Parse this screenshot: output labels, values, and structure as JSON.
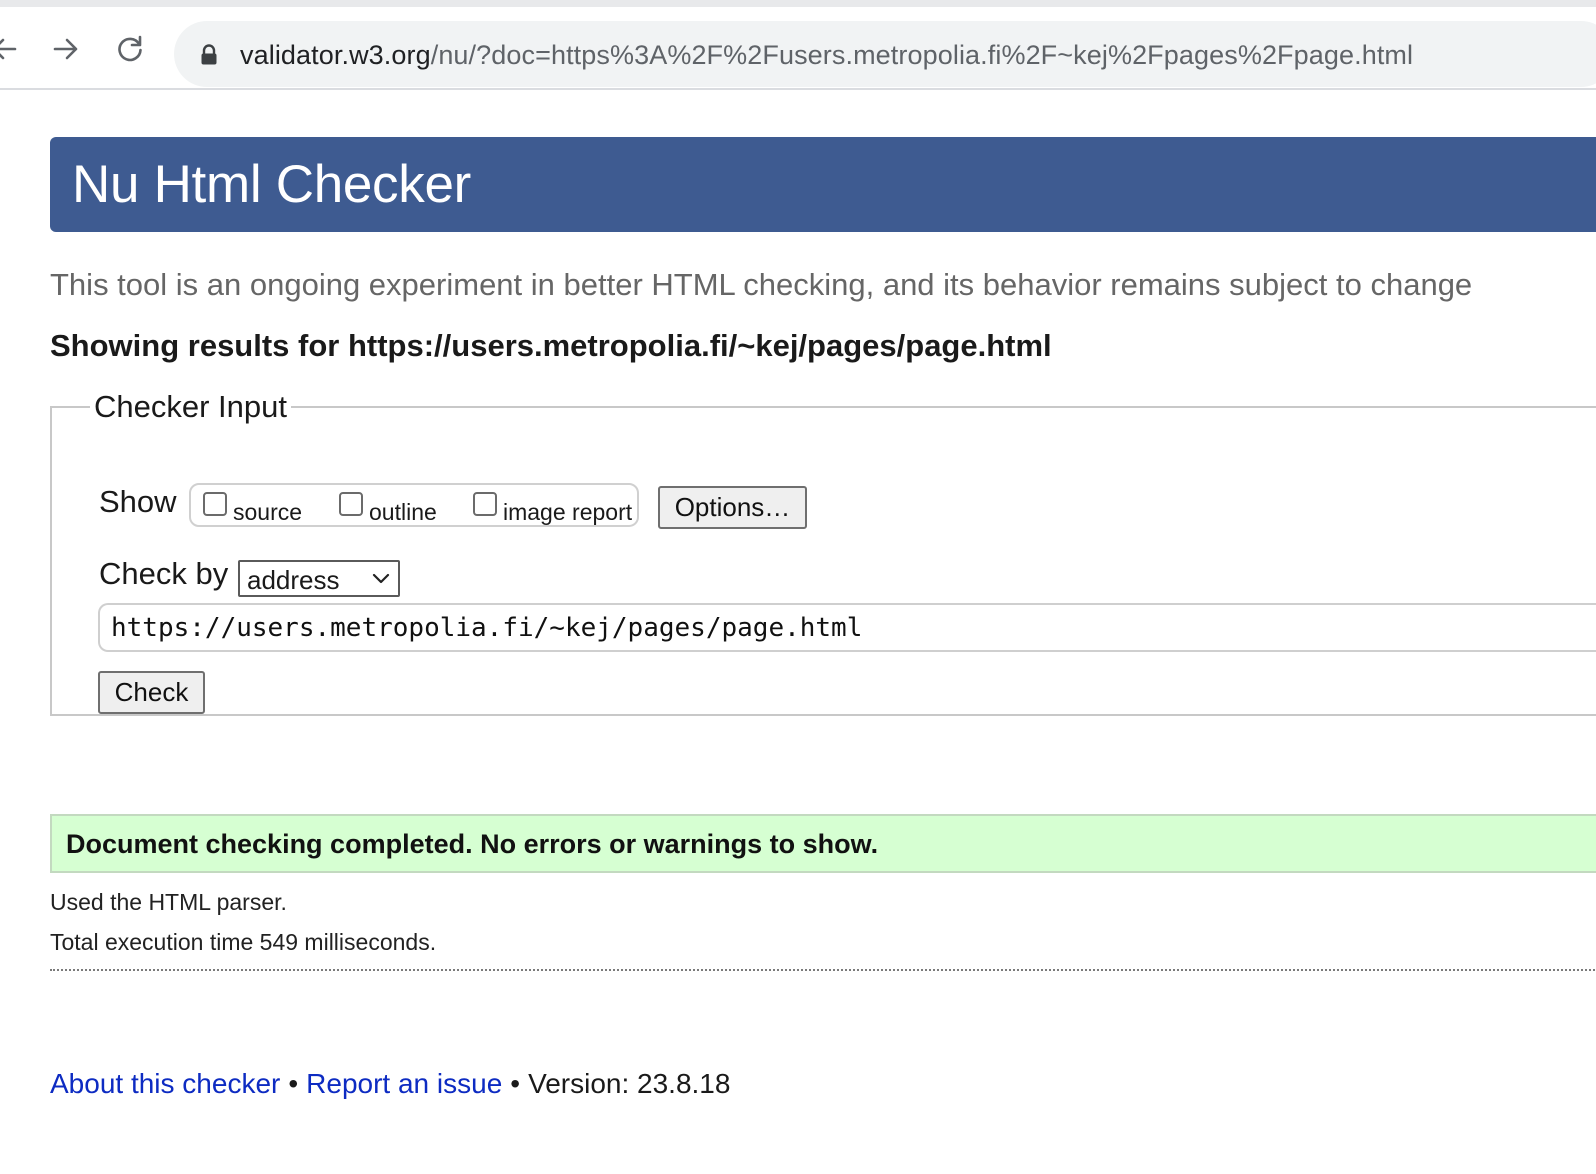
{
  "browser": {
    "url_host": "validator.w3.org",
    "url_rest": "/nu/?doc=https%3A%2F%2Fusers.metropolia.fi%2F~kej%2Fpages%2Fpage.html",
    "icons": [
      "back-arrow-icon",
      "forward-arrow-icon",
      "reload-icon",
      "lock-icon"
    ]
  },
  "page": {
    "title": "Nu Html Checker",
    "intro": "This tool is an ongoing experiment in better HTML checking, and its behavior remains subject to change",
    "results_for": "Showing results for https://users.metropolia.fi/~kej/pages/page.html"
  },
  "checker_input": {
    "legend": "Checker Input",
    "show_label": "Show",
    "checkboxes": [
      {
        "label": "source",
        "checked": false
      },
      {
        "label": "outline",
        "checked": false
      },
      {
        "label": "image report",
        "checked": false
      }
    ],
    "options_button": "Options…",
    "check_by_label": "Check by",
    "check_by_value": "address",
    "url_value": "https://users.metropolia.fi/~kej/pages/page.html",
    "check_button": "Check"
  },
  "results": {
    "message": "Document checking completed. No errors or warnings to show.",
    "parser": "Used the HTML parser.",
    "execution_time": "Total execution time 549 milliseconds."
  },
  "footer": {
    "about_link": "About this checker",
    "separator": "•",
    "report_link": "Report an issue",
    "version": "Version: 23.8.18"
  },
  "colors": {
    "header_bg": "#3e5b91",
    "success_bg": "#d6ffd2",
    "link": "#0d2bc2"
  }
}
